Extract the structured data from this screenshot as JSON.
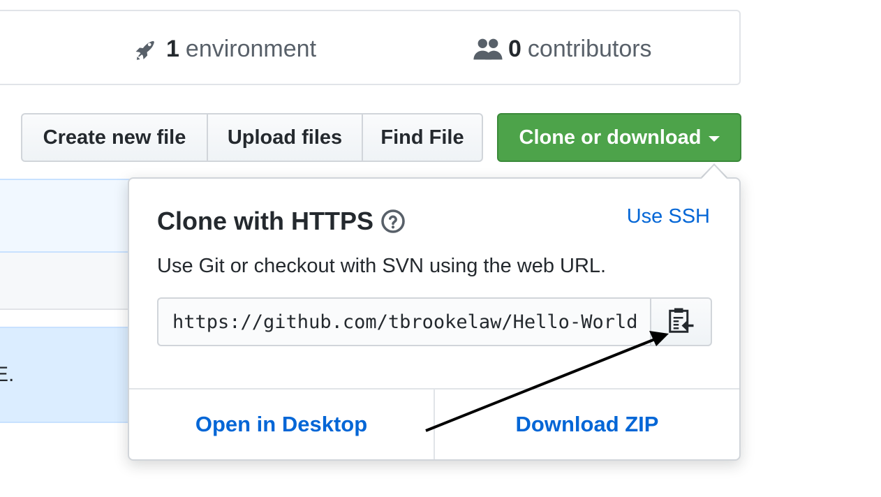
{
  "summary": {
    "environments": {
      "count": "1",
      "label": "environment",
      "icon": "rocket-icon"
    },
    "contributors": {
      "count": "0",
      "label": "contributors",
      "icon": "people-icon"
    }
  },
  "toolbar": {
    "create_label": "Create new file",
    "upload_label": "Upload files",
    "find_label": "Find File",
    "clone_label": "Clone or download"
  },
  "background": {
    "truncated_text": "E."
  },
  "clone_popover": {
    "title": "Clone with HTTPS",
    "help_icon": "question-circle-icon",
    "switch_link": "Use SSH",
    "description": "Use Git or checkout with SVN using the web URL.",
    "url_value": "https://github.com/tbrookelaw/Hello-World.git",
    "copy_icon": "clipboard-icon",
    "open_desktop_label": "Open in Desktop",
    "download_zip_label": "Download ZIP"
  },
  "colors": {
    "primary_green": "#4da34a",
    "link_blue": "#0366d6",
    "border_gray": "#d1d5da",
    "text_dark": "#24292e",
    "text_muted": "#586069"
  }
}
